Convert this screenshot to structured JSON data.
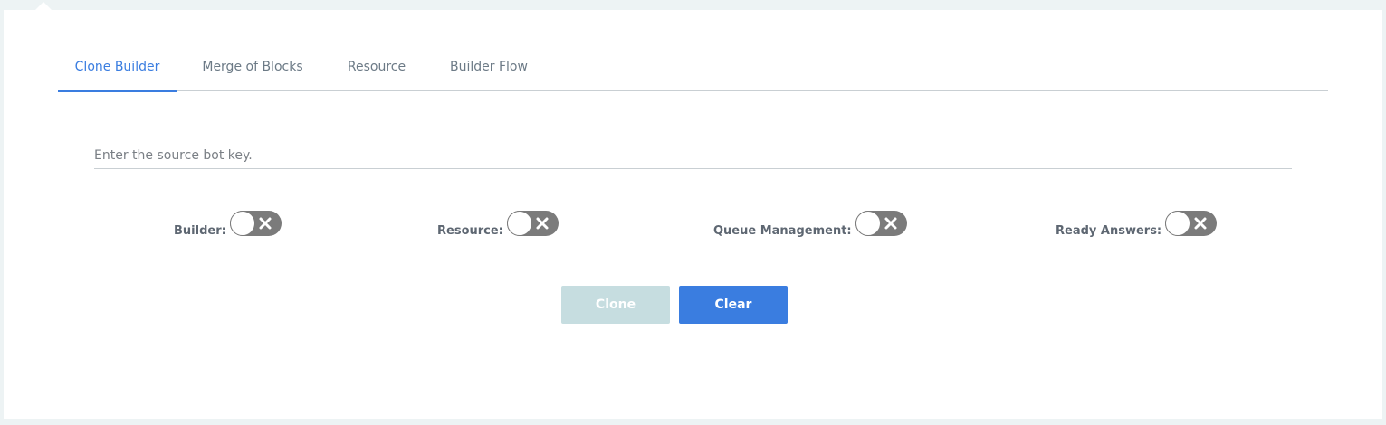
{
  "tabs": [
    {
      "label": "Clone Builder",
      "active": true
    },
    {
      "label": "Merge of Blocks",
      "active": false
    },
    {
      "label": "Resource",
      "active": false
    },
    {
      "label": "Builder Flow",
      "active": false
    }
  ],
  "source_input": {
    "placeholder": "Enter the source bot key.",
    "value": ""
  },
  "toggles": [
    {
      "label": "Builder:",
      "state": "off",
      "icon": "close-icon"
    },
    {
      "label": "Resource:",
      "state": "off",
      "icon": "close-icon"
    },
    {
      "label": "Queue Management:",
      "state": "off",
      "icon": "close-icon"
    },
    {
      "label": "Ready Answers:",
      "state": "off",
      "icon": "close-icon"
    }
  ],
  "actions": {
    "clone_label": "Clone",
    "clear_label": "Clear"
  },
  "colors": {
    "accent": "#3a7de0",
    "disabled_button": "#c6dde0",
    "toggle_off": "#7b7b7b",
    "background": "#edf3f4"
  }
}
